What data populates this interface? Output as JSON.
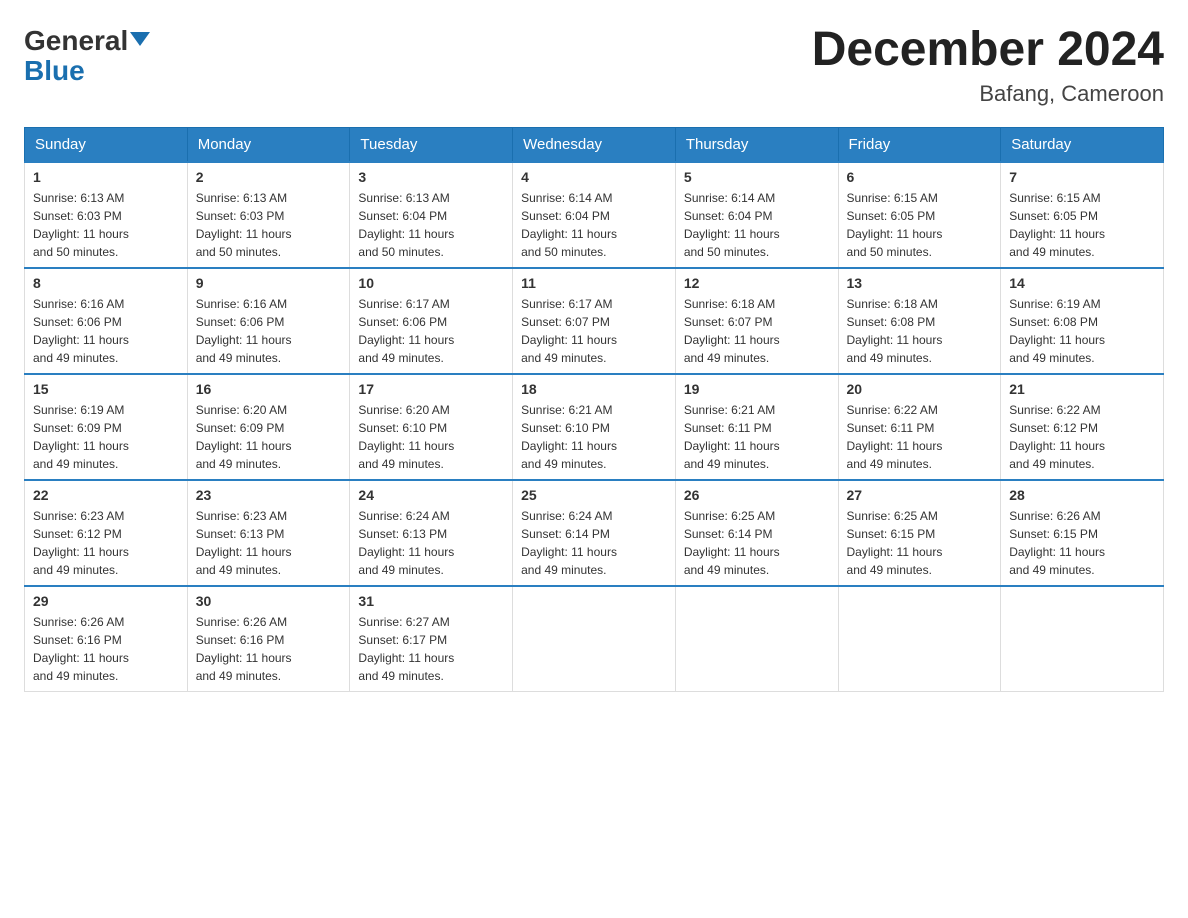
{
  "header": {
    "logo_general": "General",
    "logo_blue": "Blue",
    "title": "December 2024",
    "subtitle": "Bafang, Cameroon"
  },
  "days_of_week": [
    "Sunday",
    "Monday",
    "Tuesday",
    "Wednesday",
    "Thursday",
    "Friday",
    "Saturday"
  ],
  "weeks": [
    [
      {
        "day": "1",
        "sunrise": "6:13 AM",
        "sunset": "6:03 PM",
        "daylight": "11 hours and 50 minutes."
      },
      {
        "day": "2",
        "sunrise": "6:13 AM",
        "sunset": "6:03 PM",
        "daylight": "11 hours and 50 minutes."
      },
      {
        "day": "3",
        "sunrise": "6:13 AM",
        "sunset": "6:04 PM",
        "daylight": "11 hours and 50 minutes."
      },
      {
        "day": "4",
        "sunrise": "6:14 AM",
        "sunset": "6:04 PM",
        "daylight": "11 hours and 50 minutes."
      },
      {
        "day": "5",
        "sunrise": "6:14 AM",
        "sunset": "6:04 PM",
        "daylight": "11 hours and 50 minutes."
      },
      {
        "day": "6",
        "sunrise": "6:15 AM",
        "sunset": "6:05 PM",
        "daylight": "11 hours and 50 minutes."
      },
      {
        "day": "7",
        "sunrise": "6:15 AM",
        "sunset": "6:05 PM",
        "daylight": "11 hours and 49 minutes."
      }
    ],
    [
      {
        "day": "8",
        "sunrise": "6:16 AM",
        "sunset": "6:06 PM",
        "daylight": "11 hours and 49 minutes."
      },
      {
        "day": "9",
        "sunrise": "6:16 AM",
        "sunset": "6:06 PM",
        "daylight": "11 hours and 49 minutes."
      },
      {
        "day": "10",
        "sunrise": "6:17 AM",
        "sunset": "6:06 PM",
        "daylight": "11 hours and 49 minutes."
      },
      {
        "day": "11",
        "sunrise": "6:17 AM",
        "sunset": "6:07 PM",
        "daylight": "11 hours and 49 minutes."
      },
      {
        "day": "12",
        "sunrise": "6:18 AM",
        "sunset": "6:07 PM",
        "daylight": "11 hours and 49 minutes."
      },
      {
        "day": "13",
        "sunrise": "6:18 AM",
        "sunset": "6:08 PM",
        "daylight": "11 hours and 49 minutes."
      },
      {
        "day": "14",
        "sunrise": "6:19 AM",
        "sunset": "6:08 PM",
        "daylight": "11 hours and 49 minutes."
      }
    ],
    [
      {
        "day": "15",
        "sunrise": "6:19 AM",
        "sunset": "6:09 PM",
        "daylight": "11 hours and 49 minutes."
      },
      {
        "day": "16",
        "sunrise": "6:20 AM",
        "sunset": "6:09 PM",
        "daylight": "11 hours and 49 minutes."
      },
      {
        "day": "17",
        "sunrise": "6:20 AM",
        "sunset": "6:10 PM",
        "daylight": "11 hours and 49 minutes."
      },
      {
        "day": "18",
        "sunrise": "6:21 AM",
        "sunset": "6:10 PM",
        "daylight": "11 hours and 49 minutes."
      },
      {
        "day": "19",
        "sunrise": "6:21 AM",
        "sunset": "6:11 PM",
        "daylight": "11 hours and 49 minutes."
      },
      {
        "day": "20",
        "sunrise": "6:22 AM",
        "sunset": "6:11 PM",
        "daylight": "11 hours and 49 minutes."
      },
      {
        "day": "21",
        "sunrise": "6:22 AM",
        "sunset": "6:12 PM",
        "daylight": "11 hours and 49 minutes."
      }
    ],
    [
      {
        "day": "22",
        "sunrise": "6:23 AM",
        "sunset": "6:12 PM",
        "daylight": "11 hours and 49 minutes."
      },
      {
        "day": "23",
        "sunrise": "6:23 AM",
        "sunset": "6:13 PM",
        "daylight": "11 hours and 49 minutes."
      },
      {
        "day": "24",
        "sunrise": "6:24 AM",
        "sunset": "6:13 PM",
        "daylight": "11 hours and 49 minutes."
      },
      {
        "day": "25",
        "sunrise": "6:24 AM",
        "sunset": "6:14 PM",
        "daylight": "11 hours and 49 minutes."
      },
      {
        "day": "26",
        "sunrise": "6:25 AM",
        "sunset": "6:14 PM",
        "daylight": "11 hours and 49 minutes."
      },
      {
        "day": "27",
        "sunrise": "6:25 AM",
        "sunset": "6:15 PM",
        "daylight": "11 hours and 49 minutes."
      },
      {
        "day": "28",
        "sunrise": "6:26 AM",
        "sunset": "6:15 PM",
        "daylight": "11 hours and 49 minutes."
      }
    ],
    [
      {
        "day": "29",
        "sunrise": "6:26 AM",
        "sunset": "6:16 PM",
        "daylight": "11 hours and 49 minutes."
      },
      {
        "day": "30",
        "sunrise": "6:26 AM",
        "sunset": "6:16 PM",
        "daylight": "11 hours and 49 minutes."
      },
      {
        "day": "31",
        "sunrise": "6:27 AM",
        "sunset": "6:17 PM",
        "daylight": "11 hours and 49 minutes."
      },
      null,
      null,
      null,
      null
    ]
  ],
  "labels": {
    "sunrise": "Sunrise:",
    "sunset": "Sunset:",
    "daylight": "Daylight:"
  }
}
